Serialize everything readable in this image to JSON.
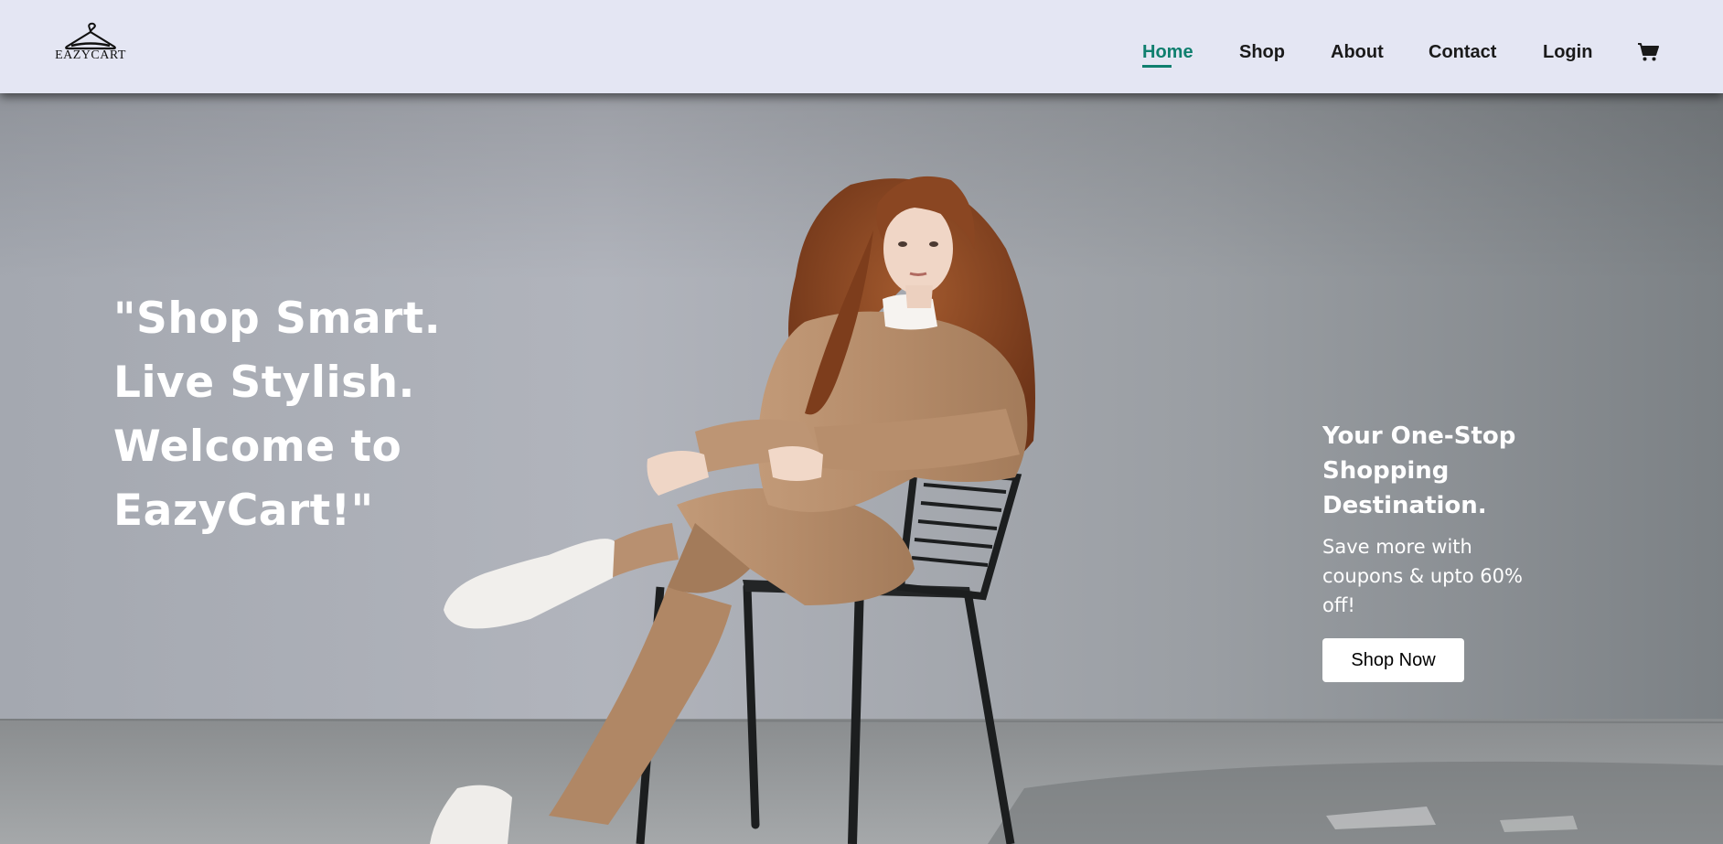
{
  "brand": {
    "logo_text": "EAZYCART",
    "logo_icon": "hanger-icon"
  },
  "nav": {
    "items": [
      {
        "label": "Home",
        "active": true
      },
      {
        "label": "Shop",
        "active": false
      },
      {
        "label": "About",
        "active": false
      },
      {
        "label": "Contact",
        "active": false
      },
      {
        "label": "Login",
        "active": false
      }
    ],
    "cart_icon": "cart-icon",
    "active_color": "#0f7f6e"
  },
  "hero": {
    "quote_lines": [
      "\"Shop Smart.",
      "Live Stylish.",
      "Welcome to",
      "EazyCart!\""
    ],
    "promo_title": "Your One-Stop Shopping Destination.",
    "promo_subtitle": "Save more with coupons & upto 60% off!",
    "cta_label": "Shop Now"
  },
  "colors": {
    "navbar_bg": "#e4e6f3",
    "hero_text": "#ffffff"
  }
}
